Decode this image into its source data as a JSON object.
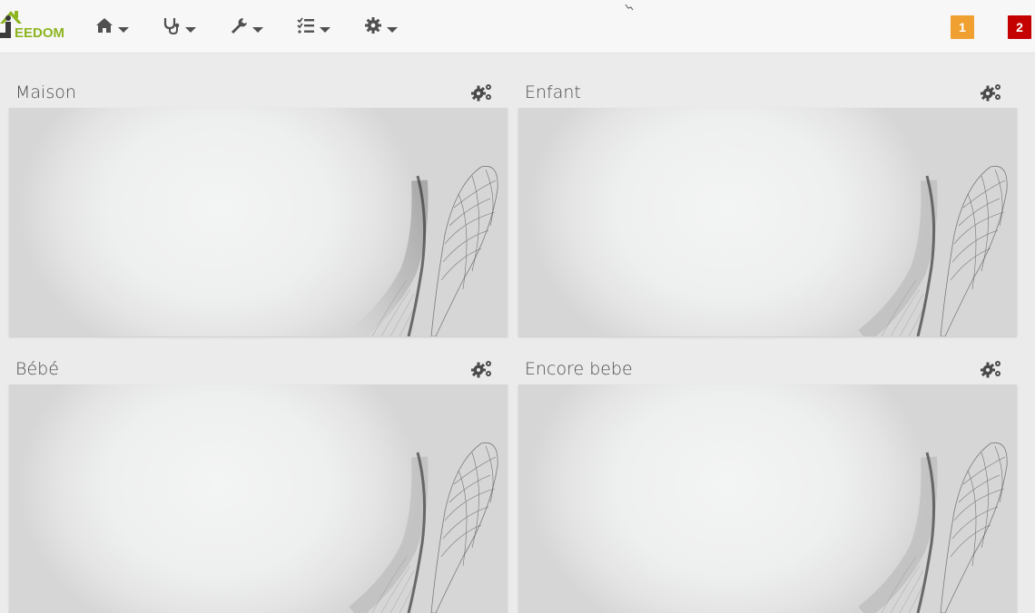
{
  "app": {
    "logo_text": "EEDOM"
  },
  "nav": {
    "items": [
      {
        "icon": "home-icon"
      },
      {
        "icon": "stethoscope-icon"
      },
      {
        "icon": "wrench-icon"
      },
      {
        "icon": "tasks-icon"
      },
      {
        "icon": "gear-icon"
      }
    ]
  },
  "notifications": {
    "badge1": {
      "count": "1",
      "color": "#f0a030"
    },
    "badge2": {
      "count": "2",
      "color": "#c40000"
    }
  },
  "objects": [
    {
      "title": "Maison"
    },
    {
      "title": "Enfant"
    },
    {
      "title": "Bébé"
    },
    {
      "title": "Encore bebe"
    }
  ],
  "colors": {
    "logo_green": "#8cb520",
    "icon_gray": "#505050"
  }
}
